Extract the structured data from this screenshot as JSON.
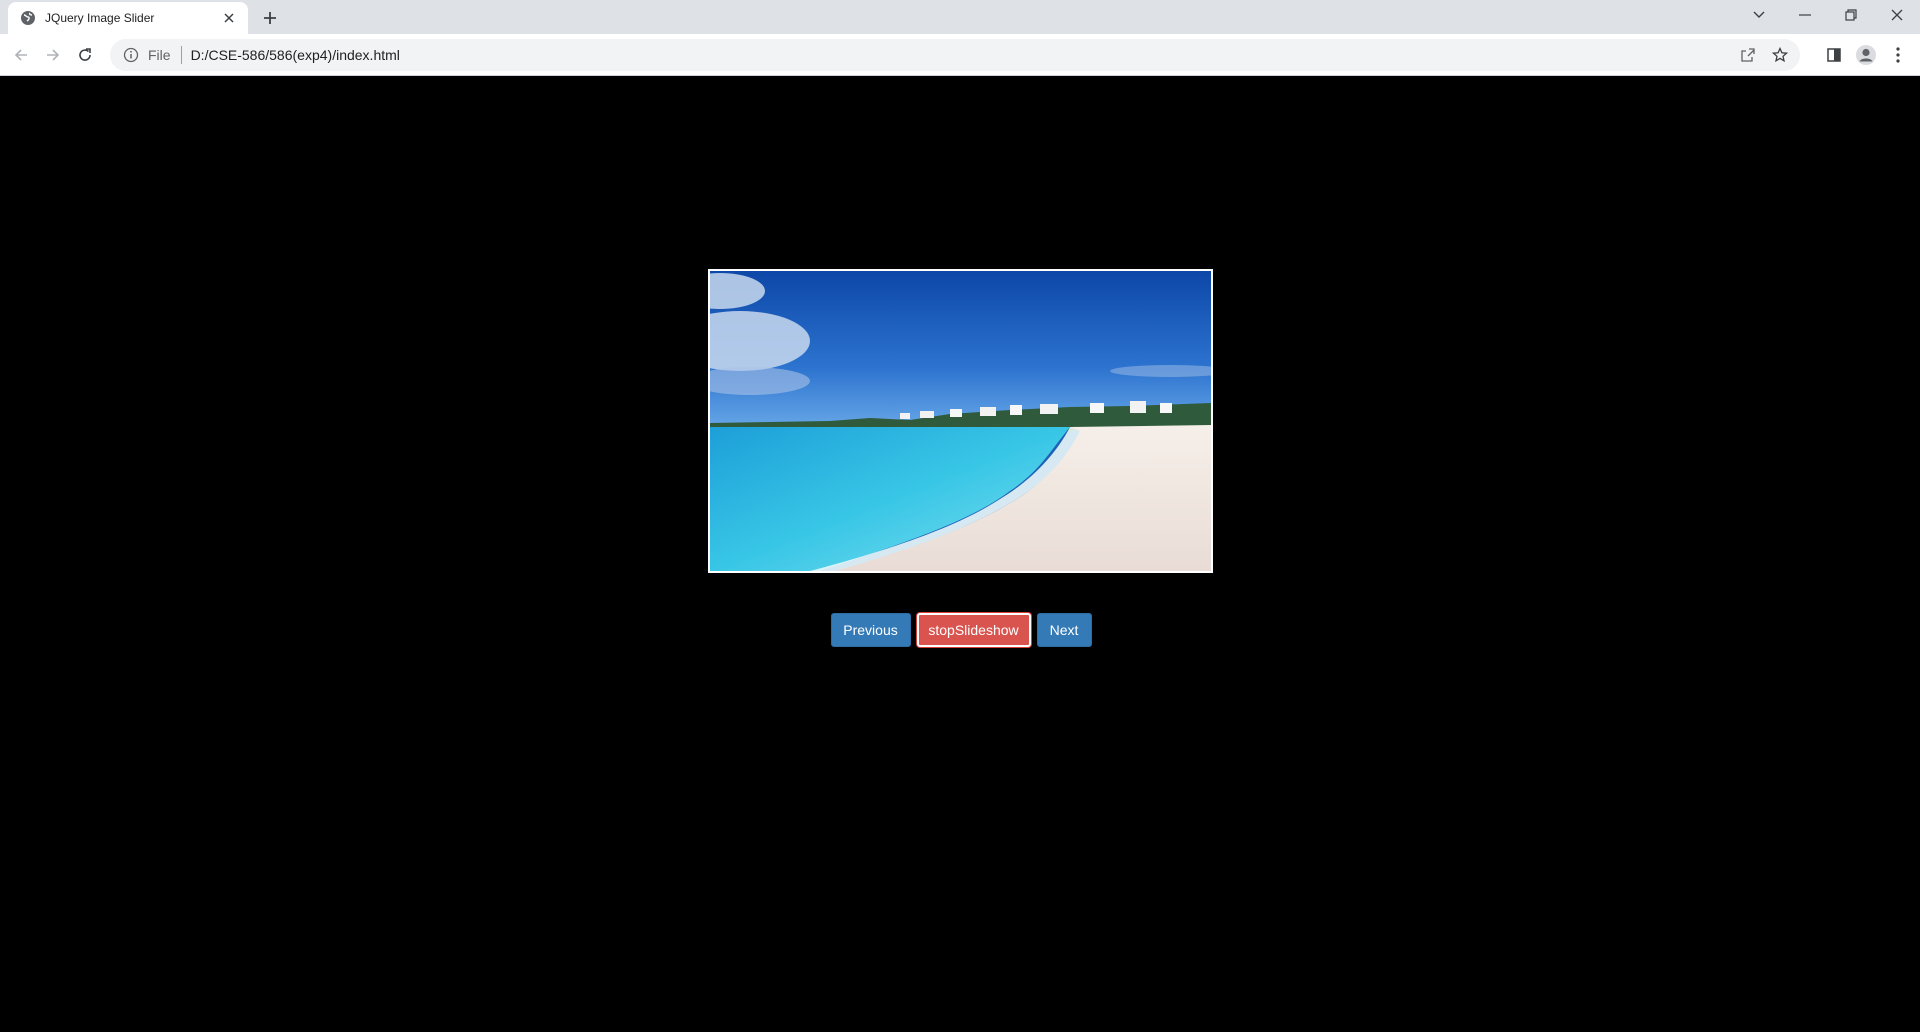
{
  "browser": {
    "tab": {
      "title": "JQuery Image Slider"
    },
    "address": {
      "scheme": "File",
      "url": "D:/CSE-586/586(exp4)/index.html"
    }
  },
  "slider": {
    "image_description_icon": "beach-photo",
    "buttons": {
      "previous": "Previous",
      "stop": "stopSlideshow",
      "next": "Next"
    }
  },
  "colors": {
    "primary_button": "#337ab7",
    "danger_button": "#d9534f",
    "page_background": "#000000"
  }
}
